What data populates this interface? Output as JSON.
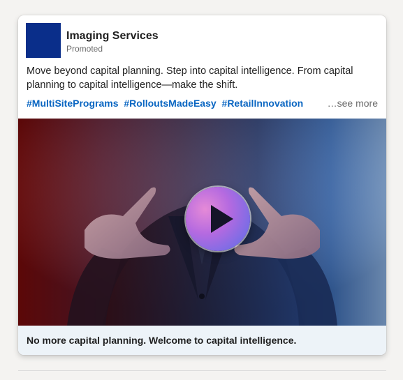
{
  "post": {
    "company_name": "Imaging Services",
    "promoted_label": "Promoted",
    "commentary": "Move beyond capital planning. Step into capital intelligence. From capital planning to capital intelligence—make the shift.",
    "hashtags": [
      "#MultiSitePrograms",
      "#RolloutsMadeEasy",
      "#RetailInnovation"
    ],
    "see_more_label": "…see more",
    "logo_color": "#0a2e8a",
    "hashtag_color": "#0a66c2"
  },
  "video": {
    "play_icon": "play-icon"
  },
  "footer": {
    "headline": "No more capital planning. Welcome to capital intelligence."
  }
}
